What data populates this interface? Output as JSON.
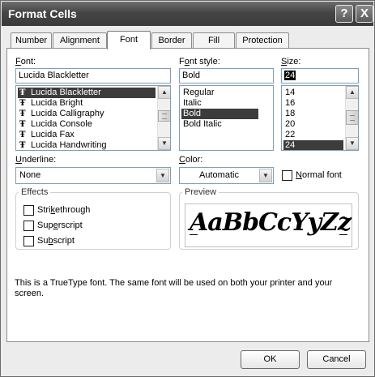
{
  "window": {
    "title": "Format Cells"
  },
  "titlebar": {
    "help_glyph": "?",
    "close_glyph": "X"
  },
  "tabs": [
    {
      "label": "Number"
    },
    {
      "label": "Alignment"
    },
    {
      "label": "Font",
      "active": true
    },
    {
      "label": "Border"
    },
    {
      "label": "Fill"
    },
    {
      "label": "Protection"
    }
  ],
  "font": {
    "label_key": "F",
    "label_rest": "ont:",
    "value": "Lucida Blackletter",
    "items": [
      "Lucida Blackletter",
      "Lucida Bright",
      "Lucida Calligraphy",
      "Lucida Console",
      "Lucida Fax",
      "Lucida Handwriting"
    ],
    "selected_index": 0,
    "item_icon": "truetype-icon"
  },
  "font_style": {
    "label_pre": "F",
    "label_key": "o",
    "label_rest": "nt style:",
    "value": "Bold",
    "items": [
      "Regular",
      "Italic",
      "Bold",
      "Bold Italic"
    ],
    "selected_index": 2
  },
  "size": {
    "label_key": "S",
    "label_rest": "ize:",
    "value": "24",
    "items": [
      "14",
      "16",
      "18",
      "20",
      "22",
      "24"
    ],
    "selected_index": 5
  },
  "underline": {
    "label_key": "U",
    "label_rest": "nderline:",
    "value": "None"
  },
  "color": {
    "label_key": "C",
    "label_rest": "olor:",
    "value": "Automatic"
  },
  "normal_font": {
    "label_key": "N",
    "label_rest": "ormal font",
    "checked": false
  },
  "effects": {
    "title": "Effects",
    "strikethrough": {
      "pre": "Stri",
      "key": "k",
      "post": "ethrough",
      "checked": false
    },
    "superscript": {
      "pre": "Sup",
      "key": "e",
      "post": "rscript",
      "checked": false
    },
    "subscript": {
      "pre": "Su",
      "key": "b",
      "post": "script",
      "checked": false
    }
  },
  "preview": {
    "title": "Preview",
    "sample": "AaBbCcYyZz"
  },
  "info_text": "This is a TrueType font.  The same font will be used on both your printer and your screen.",
  "buttons": {
    "ok": "OK",
    "cancel": "Cancel"
  },
  "colors": {
    "selection": "#3c3c3c",
    "titlebar": "#454545"
  },
  "icons": {
    "help": "help-icon",
    "close": "close-icon",
    "dropdown": "chevron-down-icon",
    "scroll_up": "chevron-up-icon",
    "scroll_down": "chevron-down-icon"
  }
}
